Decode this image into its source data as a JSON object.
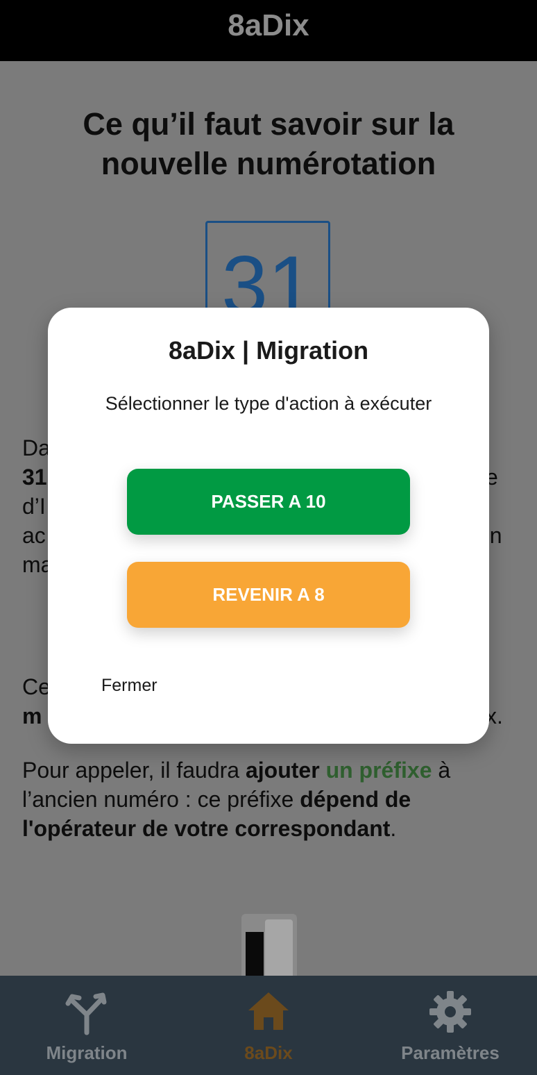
{
  "app": {
    "title": "8aDix"
  },
  "page": {
    "title": "Ce qu’il faut savoir sur la nouvelle numérotation",
    "calendar_number": "31",
    "para1_lines": [
      "Da",
      "31",
      "d’I",
      "ac",
      "ma"
    ],
    "para1_right": [
      "e",
      "en"
    ],
    "para2_lines": [
      "Ce",
      "m"
    ],
    "para2_right": "x.",
    "para3": {
      "a": "Pour appeler, il faudra ",
      "b": "ajouter",
      "c": " ",
      "d": "un préfixe",
      "e": " à l’ancien numéro : ce préfixe ",
      "f": "dépend de l'opérateur de votre correspondant",
      "g": "."
    }
  },
  "modal": {
    "title": "8aDix | Migration",
    "subtitle": "Sélectionner le type d'action à exécuter",
    "primary_button": "PASSER A 10",
    "secondary_button": "REVENIR A 8",
    "close_label": "Fermer"
  },
  "tabs": [
    {
      "label": "Migration",
      "icon": "fork-arrows-icon",
      "color": "#7f858a"
    },
    {
      "label": "8aDix",
      "icon": "home-icon",
      "color": "#6b4a1c"
    },
    {
      "label": "Paramètres",
      "icon": "gear-icon",
      "color": "#7f858a"
    }
  ],
  "colors": {
    "primary_button": "#019a43",
    "secondary_button": "#f8a636",
    "tab_bar": "#2a3640",
    "overlay_background": "#7b7b7b"
  }
}
